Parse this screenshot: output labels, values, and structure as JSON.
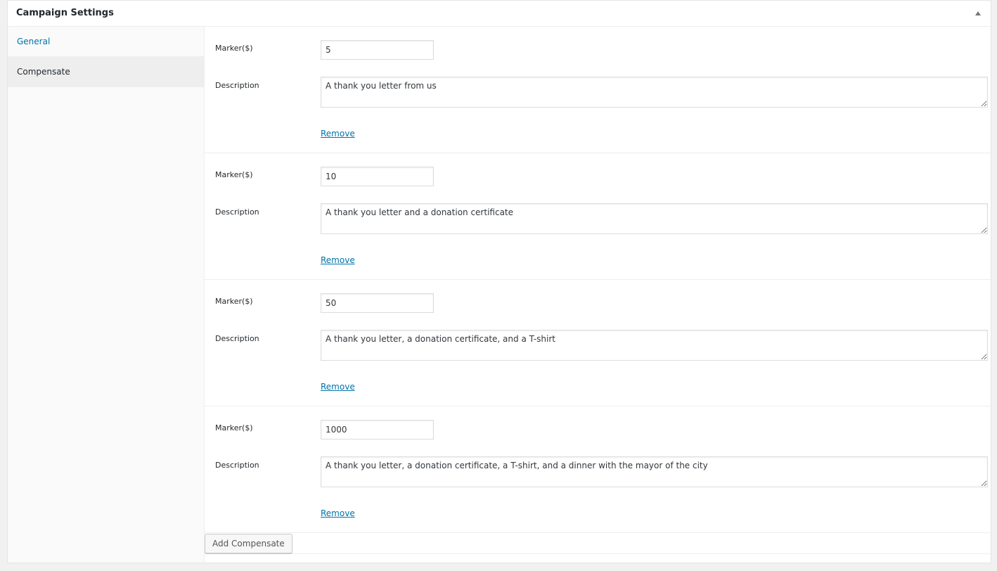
{
  "panel": {
    "title": "Campaign Settings",
    "toggle_icon": "triangle-up-icon"
  },
  "sidebar": {
    "tabs": [
      {
        "label": "General",
        "active": false
      },
      {
        "label": "Compensate",
        "active": true
      }
    ]
  },
  "compensate": {
    "marker_label": "Marker($)",
    "description_label": "Description",
    "remove_label": "Remove",
    "items": [
      {
        "marker": "5",
        "description": "A thank you letter from us"
      },
      {
        "marker": "10",
        "description": "A thank you letter and a donation certificate"
      },
      {
        "marker": "50",
        "description": "A thank you letter, a donation certificate, and a T-shirt"
      },
      {
        "marker": "1000",
        "description": "A thank you letter, a donation certificate, a T-shirt, and a dinner with the mayor of the city"
      }
    ],
    "add_button_label": "Add Compensate"
  },
  "colors": {
    "link": "#0073aa",
    "active_tab_bg": "#eeeeee",
    "sidebar_bg": "#fafafa"
  }
}
